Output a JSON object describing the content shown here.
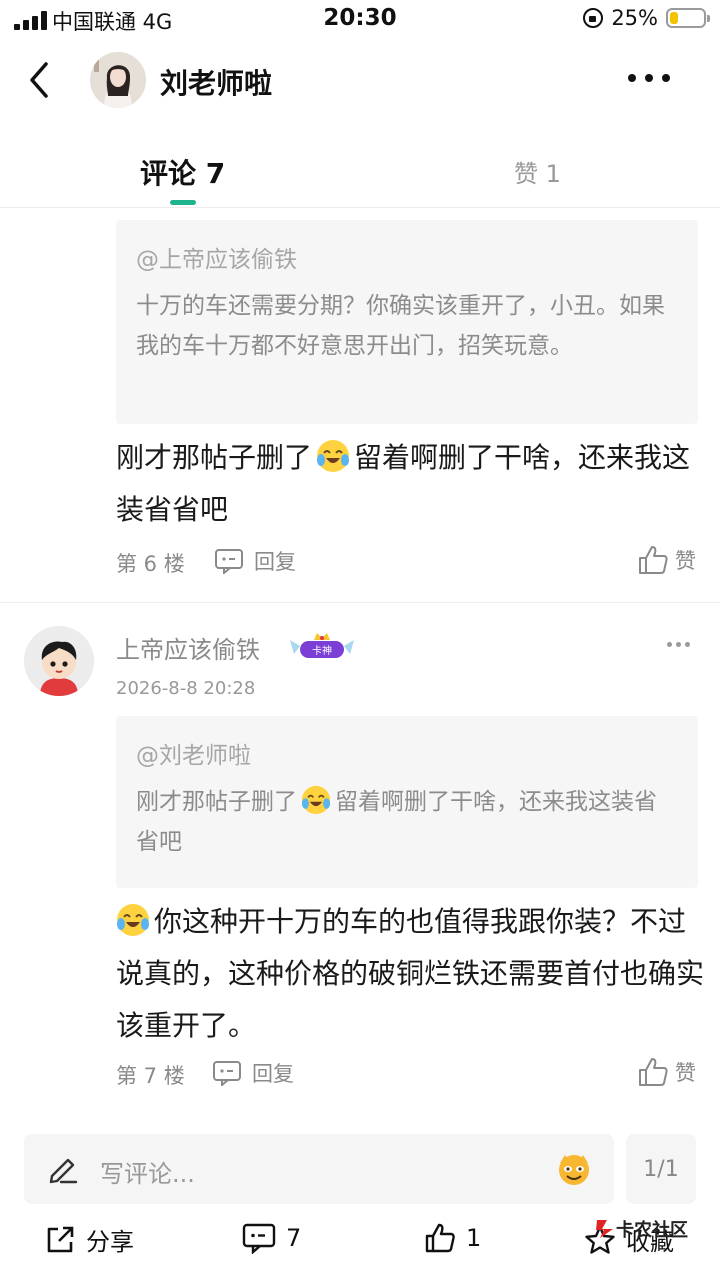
{
  "status_bar": {
    "carrier": "中国联通  4G",
    "time": "20:30",
    "battery": "25%",
    "battery_level": 0.25
  },
  "header": {
    "title": "刘老师啦"
  },
  "tabs": {
    "comments": "评论 7",
    "likes": "赞 1"
  },
  "comment6": {
    "quote_user": "@上帝应该偷铁",
    "quote_text": "十万的车还需要分期？你确实该重开了，小丑。如果我的车十万都不好意思开出门，招笑玩意。",
    "text_before_emoji": "刚才那帖子删了",
    "text_after_emoji": "留着啊删了干啥，还来我这装省省吧",
    "floor": "第 6 楼",
    "reply_label": "回复",
    "like_label": "赞"
  },
  "comment7": {
    "username": "上帝应该偷铁",
    "badge": "卡神",
    "time": "2026-8-8 20:28",
    "quote_user": "@刘老师啦",
    "quote_before_emoji": "刚才那帖子删了",
    "quote_after_emoji": "留着啊删了干啥，还来我这装省省吧",
    "text": "你这种开十万的车的也值得我跟你装？不过说真的，这种价格的破铜烂铁还需要首付也确实该重开了。",
    "floor": "第 7 楼",
    "reply_label": "回复",
    "like_label": "赞"
  },
  "input": {
    "placeholder": "写评论...",
    "page": "1/1"
  },
  "actions": {
    "share": "分享",
    "comments": "7",
    "likes": "1",
    "favorite": "收藏"
  },
  "watermark": "卡农社区",
  "colors": {
    "accent": "#1fb48d",
    "battery": "#f5c400"
  }
}
